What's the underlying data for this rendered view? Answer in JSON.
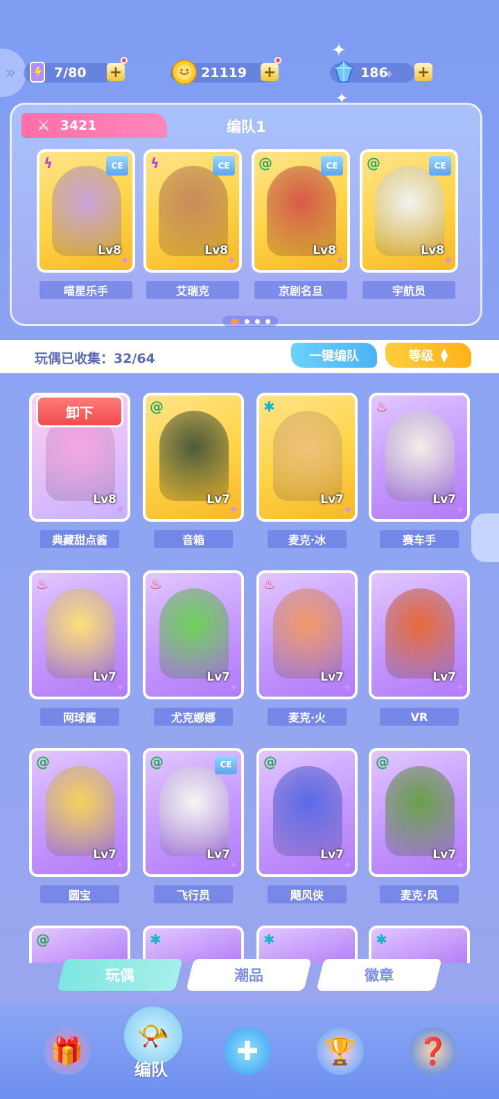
{
  "resources": [
    {
      "id": "stamina",
      "icon": "energy-scroll-icon",
      "value": "7/80"
    },
    {
      "id": "coins",
      "icon": "coin-icon",
      "value": "21119"
    },
    {
      "id": "crystals",
      "icon": "crystal-icon",
      "value": "186"
    }
  ],
  "team": {
    "power": "3421",
    "title": "编队1",
    "members": [
      {
        "name": "喵星乐手",
        "level": "Lv8",
        "element": "lightning",
        "element_glyph": "ϟ",
        "element_color": "#b743e6",
        "ce": "CE",
        "portrait_color": "#c9a3d9"
      },
      {
        "name": "艾瑞克",
        "level": "Lv8",
        "element": "lightning",
        "element_glyph": "ϟ",
        "element_color": "#b743e6",
        "ce": "CE",
        "portrait_color": "#c88a5a"
      },
      {
        "name": "京剧名旦",
        "level": "Lv8",
        "element": "wind",
        "element_glyph": "@",
        "element_color": "#26a85a",
        "ce": "CE",
        "portrait_color": "#d85a4a"
      },
      {
        "name": "宇航员",
        "level": "Lv8",
        "element": "wind",
        "element_glyph": "@",
        "element_color": "#26a85a",
        "ce": "CE",
        "portrait_color": "#f2f2f2"
      }
    ]
  },
  "collection": {
    "label": "玩偶已收集：32/64",
    "quick_team_button": "一键编队",
    "sort_button": "等级",
    "unequip_button": "卸下"
  },
  "dolls": [
    {
      "name": "典藏甜点酱",
      "level": "Lv8",
      "element": "",
      "element_glyph": "",
      "element_color": "#ffffff",
      "portrait_color": "#f5a6e8",
      "style": "pink",
      "ce": ""
    },
    {
      "name": "音箱",
      "level": "Lv7",
      "element": "wind",
      "element_glyph": "@",
      "element_color": "#26a85a",
      "portrait_color": "#4e5a3a",
      "style": "gold",
      "ce": ""
    },
    {
      "name": "麦克·冰",
      "level": "Lv7",
      "element": "ice",
      "element_glyph": "✱",
      "element_color": "#14b7c9",
      "portrait_color": "#f2c27a",
      "style": "gold",
      "ce": ""
    },
    {
      "name": "赛车手",
      "level": "Lv7",
      "element": "fire",
      "element_glyph": "♨",
      "element_color": "#ea3b3b",
      "portrait_color": "#f2eee8",
      "style": "purple",
      "ce": ""
    },
    {
      "name": "网球酱",
      "level": "Lv7",
      "element": "fire",
      "element_glyph": "♨",
      "element_color": "#ea3b3b",
      "portrait_color": "#ffe07a",
      "style": "purple",
      "ce": ""
    },
    {
      "name": "尤克娜娜",
      "level": "Lv7",
      "element": "fire",
      "element_glyph": "♨",
      "element_color": "#ea3b3b",
      "portrait_color": "#6fd25a",
      "style": "purple",
      "ce": ""
    },
    {
      "name": "麦克·火",
      "level": "Lv7",
      "element": "fire",
      "element_glyph": "♨",
      "element_color": "#ea3b3b",
      "portrait_color": "#f49a6a",
      "style": "purple",
      "ce": ""
    },
    {
      "name": "VR",
      "level": "Lv7",
      "element": "",
      "element_glyph": "",
      "element_color": "#ffffff",
      "portrait_color": "#e86a3a",
      "style": "purple",
      "ce": ""
    },
    {
      "name": "圆宝",
      "level": "Lv7",
      "element": "wind",
      "element_glyph": "@",
      "element_color": "#26a85a",
      "portrait_color": "#f6d25a",
      "style": "purple",
      "ce": ""
    },
    {
      "name": "飞行员",
      "level": "Lv7",
      "element": "wind",
      "element_glyph": "@",
      "element_color": "#26a85a",
      "portrait_color": "#f6f6f6",
      "style": "purple",
      "ce": "CE"
    },
    {
      "name": "飓风侠",
      "level": "Lv7",
      "element": "wind",
      "element_glyph": "@",
      "element_color": "#26a85a",
      "portrait_color": "#5a6ae8",
      "style": "purple",
      "ce": ""
    },
    {
      "name": "麦克·风",
      "level": "Lv7",
      "element": "wind",
      "element_glyph": "@",
      "element_color": "#26a85a",
      "portrait_color": "#6aa04a",
      "style": "purple",
      "ce": ""
    }
  ],
  "peek_row": [
    {
      "element_glyph": "@",
      "element_color": "#26a85a"
    },
    {
      "element_glyph": "✱",
      "element_color": "#14b7c9"
    },
    {
      "element_glyph": "✱",
      "element_color": "#14b7c9"
    },
    {
      "element_glyph": "✱",
      "element_color": "#14b7c9"
    }
  ],
  "tabs": [
    {
      "label": "玩偶",
      "active": true
    },
    {
      "label": "潮品",
      "active": false
    },
    {
      "label": "徽章",
      "active": false
    }
  ],
  "nav": {
    "active_label": "编队",
    "items": [
      "gift-box-icon",
      "whistle-icon",
      "gamepad-icon",
      "trophy-icon",
      "mystery-machine-icon"
    ]
  }
}
